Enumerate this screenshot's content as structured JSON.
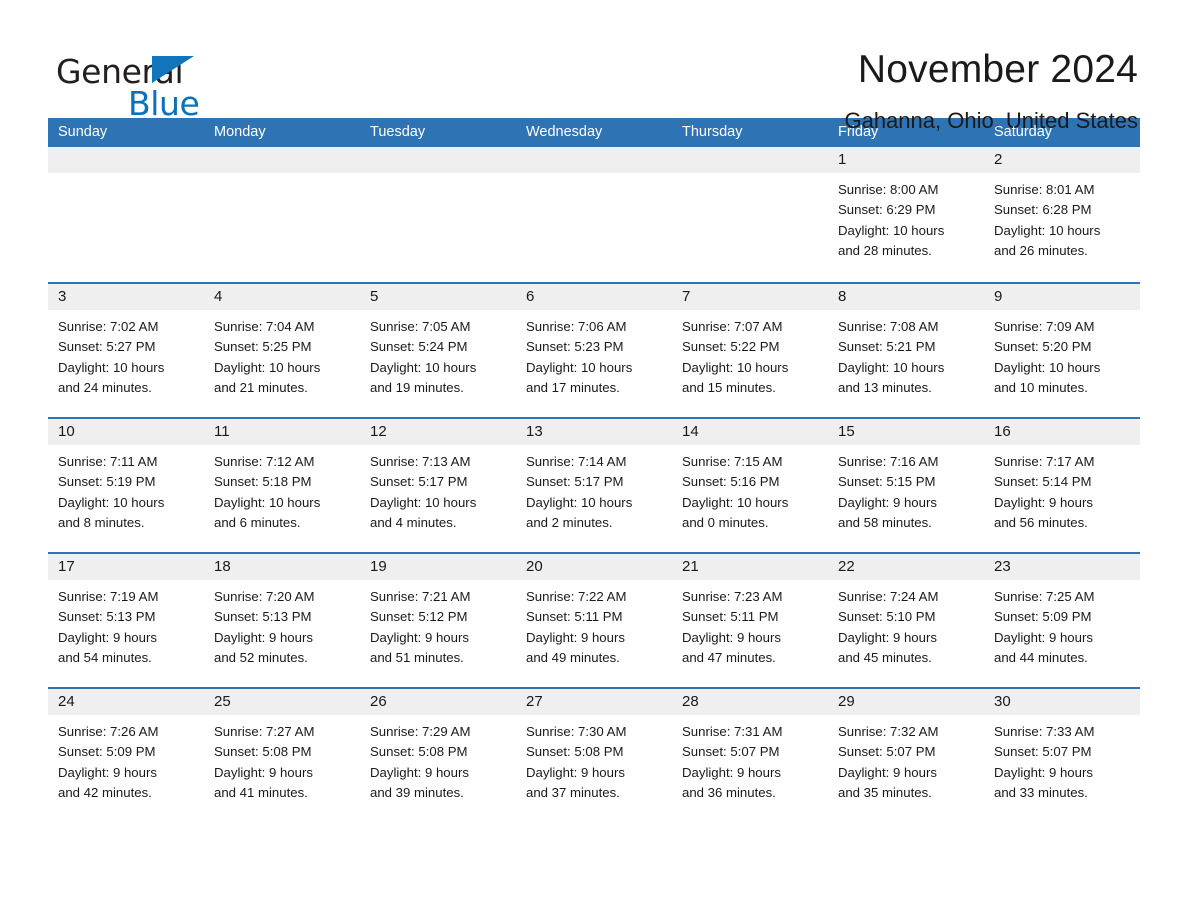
{
  "brand": {
    "word_one": "General",
    "word_two": "Blue",
    "triangle_icon": "triangle-logo-icon",
    "accent_color": "#0a72bb"
  },
  "header": {
    "title": "November 2024",
    "subtitle": "Gahanna, Ohio, United States"
  },
  "theme": {
    "header_blue": "#2e74b5",
    "day_band_gray": "#efefef",
    "text_color": "#1a1a1a"
  },
  "calendar": {
    "weekday_headers": [
      "Sunday",
      "Monday",
      "Tuesday",
      "Wednesday",
      "Thursday",
      "Friday",
      "Saturday"
    ],
    "weeks": [
      [
        {
          "day": "",
          "sunrise": "",
          "sunset": "",
          "daylight_line1": "",
          "daylight_line2": ""
        },
        {
          "day": "",
          "sunrise": "",
          "sunset": "",
          "daylight_line1": "",
          "daylight_line2": ""
        },
        {
          "day": "",
          "sunrise": "",
          "sunset": "",
          "daylight_line1": "",
          "daylight_line2": ""
        },
        {
          "day": "",
          "sunrise": "",
          "sunset": "",
          "daylight_line1": "",
          "daylight_line2": ""
        },
        {
          "day": "",
          "sunrise": "",
          "sunset": "",
          "daylight_line1": "",
          "daylight_line2": ""
        },
        {
          "day": "1",
          "sunrise": "Sunrise: 8:00 AM",
          "sunset": "Sunset: 6:29 PM",
          "daylight_line1": "Daylight: 10 hours",
          "daylight_line2": "and 28 minutes."
        },
        {
          "day": "2",
          "sunrise": "Sunrise: 8:01 AM",
          "sunset": "Sunset: 6:28 PM",
          "daylight_line1": "Daylight: 10 hours",
          "daylight_line2": "and 26 minutes."
        }
      ],
      [
        {
          "day": "3",
          "sunrise": "Sunrise: 7:02 AM",
          "sunset": "Sunset: 5:27 PM",
          "daylight_line1": "Daylight: 10 hours",
          "daylight_line2": "and 24 minutes."
        },
        {
          "day": "4",
          "sunrise": "Sunrise: 7:04 AM",
          "sunset": "Sunset: 5:25 PM",
          "daylight_line1": "Daylight: 10 hours",
          "daylight_line2": "and 21 minutes."
        },
        {
          "day": "5",
          "sunrise": "Sunrise: 7:05 AM",
          "sunset": "Sunset: 5:24 PM",
          "daylight_line1": "Daylight: 10 hours",
          "daylight_line2": "and 19 minutes."
        },
        {
          "day": "6",
          "sunrise": "Sunrise: 7:06 AM",
          "sunset": "Sunset: 5:23 PM",
          "daylight_line1": "Daylight: 10 hours",
          "daylight_line2": "and 17 minutes."
        },
        {
          "day": "7",
          "sunrise": "Sunrise: 7:07 AM",
          "sunset": "Sunset: 5:22 PM",
          "daylight_line1": "Daylight: 10 hours",
          "daylight_line2": "and 15 minutes."
        },
        {
          "day": "8",
          "sunrise": "Sunrise: 7:08 AM",
          "sunset": "Sunset: 5:21 PM",
          "daylight_line1": "Daylight: 10 hours",
          "daylight_line2": "and 13 minutes."
        },
        {
          "day": "9",
          "sunrise": "Sunrise: 7:09 AM",
          "sunset": "Sunset: 5:20 PM",
          "daylight_line1": "Daylight: 10 hours",
          "daylight_line2": "and 10 minutes."
        }
      ],
      [
        {
          "day": "10",
          "sunrise": "Sunrise: 7:11 AM",
          "sunset": "Sunset: 5:19 PM",
          "daylight_line1": "Daylight: 10 hours",
          "daylight_line2": "and 8 minutes."
        },
        {
          "day": "11",
          "sunrise": "Sunrise: 7:12 AM",
          "sunset": "Sunset: 5:18 PM",
          "daylight_line1": "Daylight: 10 hours",
          "daylight_line2": "and 6 minutes."
        },
        {
          "day": "12",
          "sunrise": "Sunrise: 7:13 AM",
          "sunset": "Sunset: 5:17 PM",
          "daylight_line1": "Daylight: 10 hours",
          "daylight_line2": "and 4 minutes."
        },
        {
          "day": "13",
          "sunrise": "Sunrise: 7:14 AM",
          "sunset": "Sunset: 5:17 PM",
          "daylight_line1": "Daylight: 10 hours",
          "daylight_line2": "and 2 minutes."
        },
        {
          "day": "14",
          "sunrise": "Sunrise: 7:15 AM",
          "sunset": "Sunset: 5:16 PM",
          "daylight_line1": "Daylight: 10 hours",
          "daylight_line2": "and 0 minutes."
        },
        {
          "day": "15",
          "sunrise": "Sunrise: 7:16 AM",
          "sunset": "Sunset: 5:15 PM",
          "daylight_line1": "Daylight: 9 hours",
          "daylight_line2": "and 58 minutes."
        },
        {
          "day": "16",
          "sunrise": "Sunrise: 7:17 AM",
          "sunset": "Sunset: 5:14 PM",
          "daylight_line1": "Daylight: 9 hours",
          "daylight_line2": "and 56 minutes."
        }
      ],
      [
        {
          "day": "17",
          "sunrise": "Sunrise: 7:19 AM",
          "sunset": "Sunset: 5:13 PM",
          "daylight_line1": "Daylight: 9 hours",
          "daylight_line2": "and 54 minutes."
        },
        {
          "day": "18",
          "sunrise": "Sunrise: 7:20 AM",
          "sunset": "Sunset: 5:13 PM",
          "daylight_line1": "Daylight: 9 hours",
          "daylight_line2": "and 52 minutes."
        },
        {
          "day": "19",
          "sunrise": "Sunrise: 7:21 AM",
          "sunset": "Sunset: 5:12 PM",
          "daylight_line1": "Daylight: 9 hours",
          "daylight_line2": "and 51 minutes."
        },
        {
          "day": "20",
          "sunrise": "Sunrise: 7:22 AM",
          "sunset": "Sunset: 5:11 PM",
          "daylight_line1": "Daylight: 9 hours",
          "daylight_line2": "and 49 minutes."
        },
        {
          "day": "21",
          "sunrise": "Sunrise: 7:23 AM",
          "sunset": "Sunset: 5:11 PM",
          "daylight_line1": "Daylight: 9 hours",
          "daylight_line2": "and 47 minutes."
        },
        {
          "day": "22",
          "sunrise": "Sunrise: 7:24 AM",
          "sunset": "Sunset: 5:10 PM",
          "daylight_line1": "Daylight: 9 hours",
          "daylight_line2": "and 45 minutes."
        },
        {
          "day": "23",
          "sunrise": "Sunrise: 7:25 AM",
          "sunset": "Sunset: 5:09 PM",
          "daylight_line1": "Daylight: 9 hours",
          "daylight_line2": "and 44 minutes."
        }
      ],
      [
        {
          "day": "24",
          "sunrise": "Sunrise: 7:26 AM",
          "sunset": "Sunset: 5:09 PM",
          "daylight_line1": "Daylight: 9 hours",
          "daylight_line2": "and 42 minutes."
        },
        {
          "day": "25",
          "sunrise": "Sunrise: 7:27 AM",
          "sunset": "Sunset: 5:08 PM",
          "daylight_line1": "Daylight: 9 hours",
          "daylight_line2": "and 41 minutes."
        },
        {
          "day": "26",
          "sunrise": "Sunrise: 7:29 AM",
          "sunset": "Sunset: 5:08 PM",
          "daylight_line1": "Daylight: 9 hours",
          "daylight_line2": "and 39 minutes."
        },
        {
          "day": "27",
          "sunrise": "Sunrise: 7:30 AM",
          "sunset": "Sunset: 5:08 PM",
          "daylight_line1": "Daylight: 9 hours",
          "daylight_line2": "and 37 minutes."
        },
        {
          "day": "28",
          "sunrise": "Sunrise: 7:31 AM",
          "sunset": "Sunset: 5:07 PM",
          "daylight_line1": "Daylight: 9 hours",
          "daylight_line2": "and 36 minutes."
        },
        {
          "day": "29",
          "sunrise": "Sunrise: 7:32 AM",
          "sunset": "Sunset: 5:07 PM",
          "daylight_line1": "Daylight: 9 hours",
          "daylight_line2": "and 35 minutes."
        },
        {
          "day": "30",
          "sunrise": "Sunrise: 7:33 AM",
          "sunset": "Sunset: 5:07 PM",
          "daylight_line1": "Daylight: 9 hours",
          "daylight_line2": "and 33 minutes."
        }
      ]
    ]
  }
}
